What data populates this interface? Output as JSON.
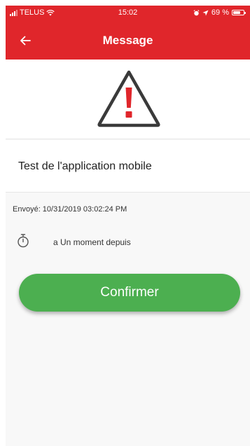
{
  "status_bar": {
    "carrier": "TELUS",
    "time": "15:02",
    "battery_percent": "69 %",
    "battery_level": 0.69
  },
  "nav": {
    "title": "Message"
  },
  "message": {
    "title": "Test de l'application mobile",
    "sent": "Envoyé: 10/31/2019 03:02:24 PM",
    "elapsed": "a Un moment depuis"
  },
  "actions": {
    "confirm_label": "Confirmer"
  },
  "colors": {
    "header": "#e0262b",
    "confirm": "#4caf50",
    "warning_mark": "#e0262b"
  },
  "icons": {
    "back": "arrow-left-icon",
    "warning": "warning-triangle-icon",
    "timer": "stopwatch-icon"
  }
}
